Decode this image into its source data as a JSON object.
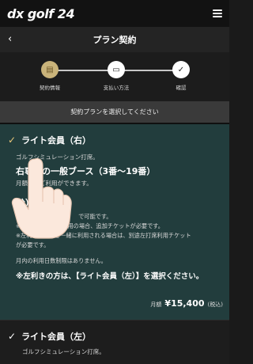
{
  "header": {
    "logo": "dx golf 24",
    "menu_icon": "hamburger-menu-icon"
  },
  "subheader": {
    "back_label": "‹",
    "title": "プラン契約"
  },
  "steps": [
    {
      "label": "契約情報",
      "icon": "contract-icon",
      "state": "active"
    },
    {
      "label": "支払い方法",
      "icon": "credit-card-icon",
      "state": "todo"
    },
    {
      "label": "確認",
      "icon": "checkmark-icon",
      "state": "todo"
    }
  ],
  "instruction": "契約プランを選択してください",
  "plans": [
    {
      "selected": true,
      "check": "✓",
      "name": "ライト会員（右）",
      "desc": "ゴルフシミュレーション打席。",
      "booth": "右専用の一般ブース（3番〜19番）",
      "partial_line": "月額制でご利用ができます。",
      "time_left": "（",
      "time_text": "分）まで",
      "notes": [
        "事前　　　　　　　　　で可能です。",
        "※1日2時間以上ご利用の場合、追加チケットが必要です。",
        "※左利きの方とご一緒に利用される場合は、別途左打席利用チケット",
        "が必要です。",
        "",
        "月内の利用日数制限はありません。"
      ],
      "notice": "※左利きの方は、【ライト会員（左）】を選択ください。",
      "price_label": "月額",
      "price": "¥15,400",
      "tax": "(税込)"
    },
    {
      "selected": false,
      "check": "✓",
      "name": "ライト会員（左）",
      "desc": "ゴルフシミュレーション打席。"
    }
  ],
  "colors": {
    "accent": "#c9b37a",
    "card_selected": "#223d3d",
    "background": "#1a1a1a"
  }
}
